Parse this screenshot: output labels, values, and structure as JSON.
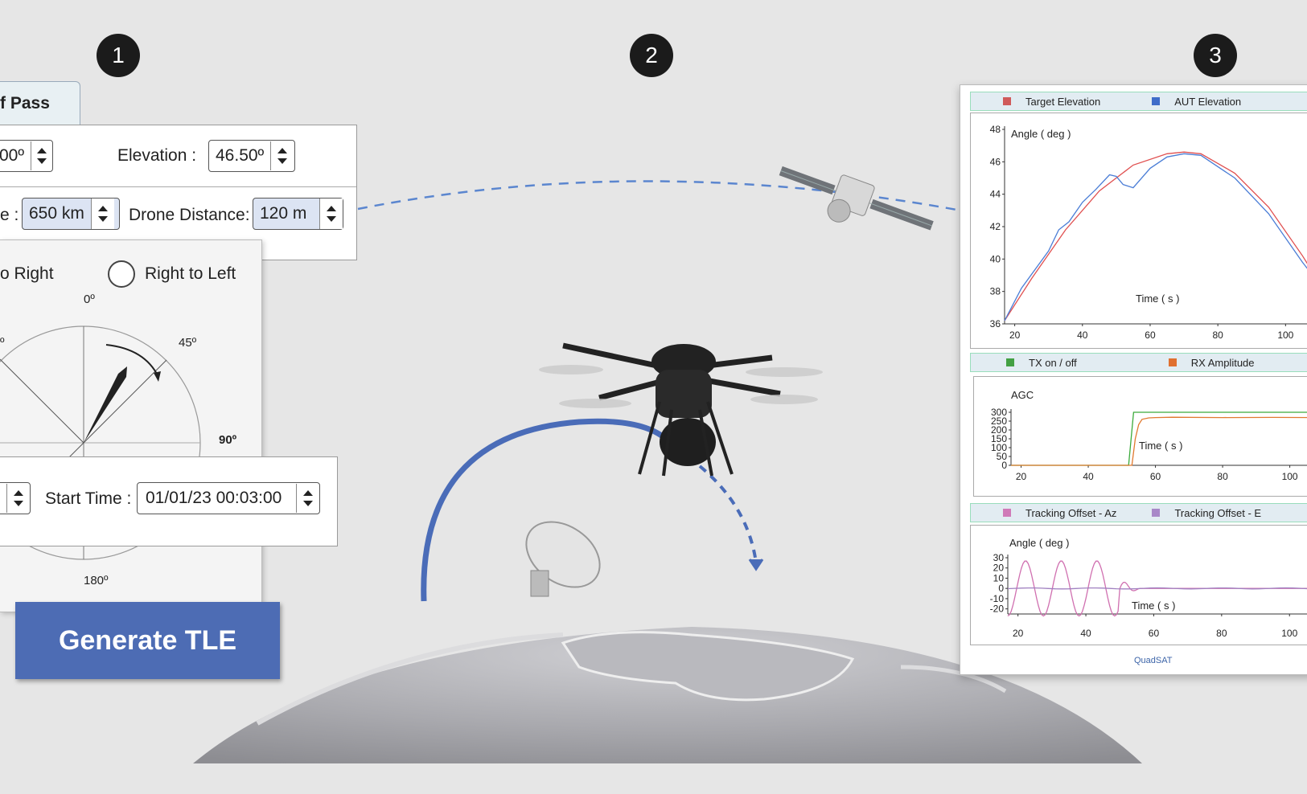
{
  "steps": [
    "1",
    "2",
    "3"
  ],
  "pass_panel": {
    "tab_label": "f Pass"
  },
  "params": {
    "azimuth_value_partial": "00º",
    "elevation_label": "Elevation :",
    "elevation_value": "46.50º",
    "altitude_label_partial": "e :",
    "altitude_value": "650 km",
    "drone_distance_label": "Drone Distance:",
    "drone_distance_value": "120 m"
  },
  "direction": {
    "left_to_right_partial": "o Right",
    "right_to_left": "Right to Left"
  },
  "compass": {
    "n": "0º",
    "ne": "45º",
    "e": "90º",
    "s": "180º",
    "w_partial": "º"
  },
  "time": {
    "start_label": "Start Time :",
    "start_value": "01/01/23 00:03:00"
  },
  "generate_button": "Generate TLE",
  "brand": "QuadSAT",
  "chart_data": [
    {
      "type": "line",
      "legend": [
        "Target Elevation",
        "AUT Elevation"
      ],
      "ylabel": "Angle ( deg )",
      "xlabel": "Time ( s )",
      "ylim": [
        36,
        48
      ],
      "yticks": [
        36,
        38,
        40,
        42,
        44,
        46,
        48
      ],
      "xticks": [
        20,
        40,
        60,
        80,
        100
      ],
      "xlim": [
        17,
        108
      ],
      "series": [
        {
          "name": "Target Elevation",
          "color": "#e05050",
          "x": [
            17,
            25,
            35,
            45,
            55,
            65,
            70,
            75,
            85,
            95,
            105,
            108
          ],
          "y": [
            36.2,
            38.8,
            41.8,
            44.2,
            45.8,
            46.5,
            46.6,
            46.5,
            45.3,
            43.2,
            40.2,
            39.2
          ]
        },
        {
          "name": "AUT Elevation",
          "color": "#4a7dd6",
          "x": [
            17,
            22,
            30,
            33,
            36,
            40,
            44,
            48,
            50,
            52,
            55,
            60,
            65,
            70,
            75,
            85,
            95,
            105,
            108
          ],
          "y": [
            36.2,
            38.2,
            40.5,
            41.8,
            42.3,
            43.5,
            44.3,
            45.2,
            45.1,
            44.6,
            44.4,
            45.6,
            46.3,
            46.5,
            46.4,
            45.0,
            42.8,
            39.8,
            39.0
          ]
        }
      ]
    },
    {
      "type": "line",
      "legend": [
        "TX on / off",
        "RX Amplitude"
      ],
      "ylabel": "AGC",
      "xlabel": "Time ( s )",
      "ylim": [
        0,
        300
      ],
      "yticks": [
        0,
        50,
        100,
        150,
        200,
        250,
        300
      ],
      "xticks": [
        20,
        40,
        60,
        80,
        100
      ],
      "xlim": [
        17,
        108
      ],
      "series": [
        {
          "name": "TX on / off",
          "color": "#3aaa3a",
          "x": [
            17,
            52,
            53.5,
            108
          ],
          "y": [
            0,
            0,
            300,
            300
          ]
        },
        {
          "name": "RX Amplitude",
          "color": "#e07a30",
          "x": [
            17,
            53,
            54,
            55,
            56,
            58,
            60,
            65,
            80,
            95,
            108
          ],
          "y": [
            0,
            0,
            150,
            230,
            260,
            268,
            270,
            272,
            270,
            271,
            270
          ]
        }
      ]
    },
    {
      "type": "line",
      "legend": [
        "Tracking Offset - Az",
        "Tracking Offset - E"
      ],
      "ylabel": "Angle ( deg )",
      "xlabel": "Time ( s )",
      "ylim": [
        -25,
        30
      ],
      "yticks": [
        -20,
        -10,
        0,
        10,
        20,
        30
      ],
      "xticks": [
        20,
        40,
        60,
        80,
        100
      ],
      "xlim": [
        17,
        108
      ],
      "series": [
        {
          "name": "Tracking Offset - Az",
          "color": "#d070b0",
          "fn": "azwave"
        },
        {
          "name": "Tracking Offset - E",
          "color": "#a080c0",
          "fn": "elflat"
        }
      ]
    }
  ]
}
